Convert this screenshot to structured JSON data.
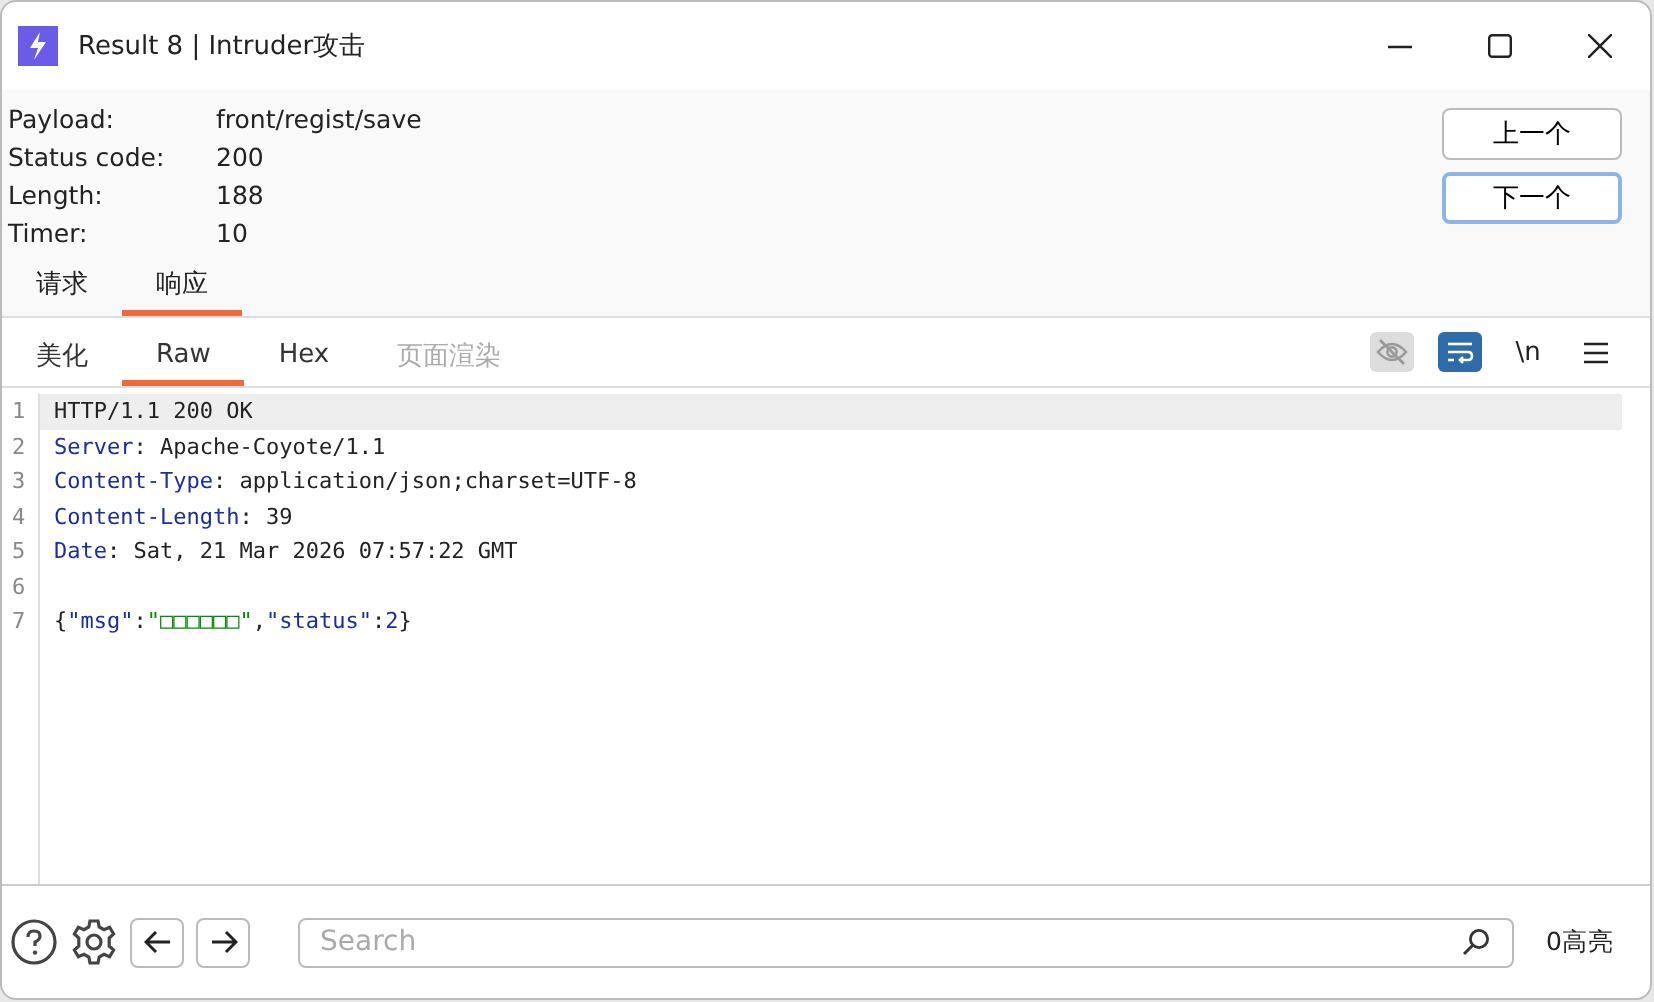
{
  "window": {
    "title": "Result 8 | Intruder攻击"
  },
  "details": [
    {
      "label": "Payload:",
      "value": "front/regist/save"
    },
    {
      "label": "Status code:",
      "value": "200"
    },
    {
      "label": "Length:",
      "value": "188"
    },
    {
      "label": "Timer:",
      "value": "10"
    }
  ],
  "nav_buttons": [
    {
      "label": "上一个",
      "focused": false
    },
    {
      "label": "下一个",
      "focused": true
    }
  ],
  "tabs": [
    {
      "label": "请求",
      "selected": false
    },
    {
      "label": "响应",
      "selected": true
    }
  ],
  "view_tabs": [
    {
      "label": "美化",
      "selected": false,
      "disabled": false
    },
    {
      "label": "Raw",
      "selected": true,
      "disabled": false
    },
    {
      "label": "Hex",
      "selected": false,
      "disabled": false
    },
    {
      "label": "页面渲染",
      "selected": false,
      "disabled": true
    }
  ],
  "view_tools": [
    {
      "kind": "hide",
      "on": false
    },
    {
      "kind": "wrap",
      "on": true
    },
    {
      "kind": "text",
      "label": "\\n"
    },
    {
      "kind": "menu"
    }
  ],
  "editor": {
    "lines": [
      {
        "number": "1",
        "highlighted": true,
        "segments": [
          {
            "kind": "plain",
            "text": "HTTP/1.1 200 OK"
          }
        ]
      },
      {
        "number": "2",
        "highlighted": false,
        "segments": [
          {
            "kind": "key",
            "text": "Server"
          },
          {
            "kind": "plain",
            "text": ": Apache-Coyote/1.1"
          }
        ]
      },
      {
        "number": "3",
        "highlighted": false,
        "segments": [
          {
            "kind": "key",
            "text": "Content-Type"
          },
          {
            "kind": "plain",
            "text": ": application/json;charset=UTF-8"
          }
        ]
      },
      {
        "number": "4",
        "highlighted": false,
        "segments": [
          {
            "kind": "key",
            "text": "Content-Length"
          },
          {
            "kind": "plain",
            "text": ": 39"
          }
        ]
      },
      {
        "number": "5",
        "highlighted": false,
        "segments": [
          {
            "kind": "key",
            "text": "Date"
          },
          {
            "kind": "plain",
            "text": ": Sat, 21 Mar 2026 07:57:22 GMT"
          }
        ]
      },
      {
        "number": "6",
        "highlighted": false
      },
      {
        "number": "7",
        "highlighted": false,
        "segments": [
          {
            "kind": "plain",
            "text": "{"
          },
          {
            "kind": "key",
            "text": "\"msg\""
          },
          {
            "kind": "plain",
            "text": ":"
          },
          {
            "kind": "string",
            "text": "\"□□□□□□\""
          },
          {
            "kind": "plain",
            "text": ","
          },
          {
            "kind": "key",
            "text": "\"status\""
          },
          {
            "kind": "plain",
            "text": ":"
          },
          {
            "kind": "number",
            "text": "2"
          },
          {
            "kind": "plain",
            "text": "}"
          }
        ]
      }
    ]
  },
  "footer": {
    "search": {
      "placeholder": "Search"
    },
    "highlights": "0高亮"
  }
}
